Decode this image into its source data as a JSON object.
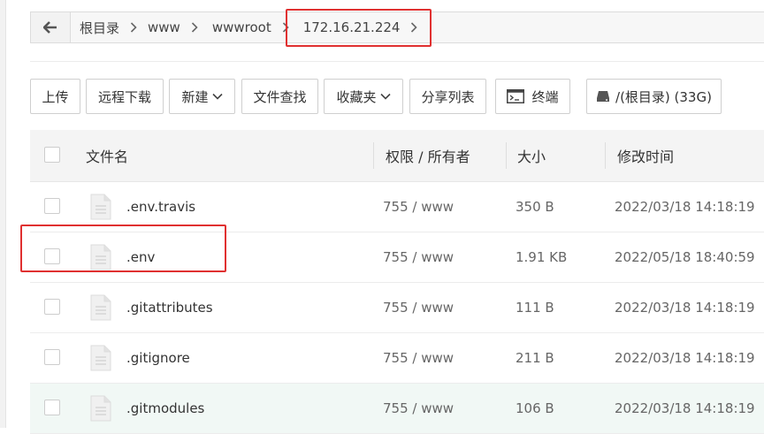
{
  "breadcrumb": {
    "back_icon": "arrow-left-icon",
    "items": [
      {
        "label": "根目录"
      },
      {
        "label": "www"
      },
      {
        "label": "wwwroot"
      },
      {
        "label": "172.16.21.224"
      }
    ]
  },
  "toolbar": {
    "upload": "上传",
    "remote_download": "远程下载",
    "new": "新建",
    "search_content": "文件查找",
    "favorites": "收藏夹",
    "share_list": "分享列表",
    "terminal": "终端",
    "terminal_icon": "terminal-icon",
    "disk": "/(根目录) (33G)",
    "disk_icon": "hard-drive-icon"
  },
  "table": {
    "headers": {
      "name": "文件名",
      "perm": "权限 / 所有者",
      "size": "大小",
      "mtime": "修改时间"
    },
    "rows": [
      {
        "name": ".env.travis",
        "perm": "755 / www",
        "size": "350 B",
        "mtime": "2022/03/18 14:18:19"
      },
      {
        "name": ".env",
        "perm": "755 / www",
        "size": "1.91 KB",
        "mtime": "2022/05/18 18:40:59"
      },
      {
        "name": ".gitattributes",
        "perm": "755 / www",
        "size": "111 B",
        "mtime": "2022/03/18 14:18:19"
      },
      {
        "name": ".gitignore",
        "perm": "755 / www",
        "size": "211 B",
        "mtime": "2022/03/18 14:18:19"
      },
      {
        "name": ".gitmodules",
        "perm": "755 / www",
        "size": "106 B",
        "mtime": "2022/03/18 14:18:19"
      }
    ]
  },
  "colors": {
    "highlight": "#e03030",
    "hover_row": "#f1f8f5"
  }
}
